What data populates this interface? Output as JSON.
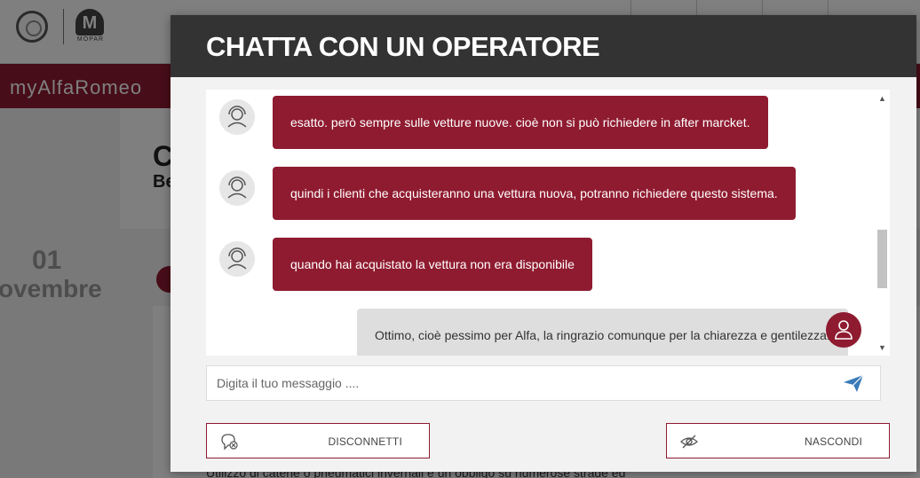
{
  "background": {
    "brand_name": "myAlfaRomeo",
    "logo_secondary_text": "MOPAR",
    "logo_secondary_letter": "M",
    "title_initial": "C",
    "subtitle_initial": "Be",
    "date_day": "01",
    "date_month": "ovembre",
    "bottom_text": "Utilizzo di catene o pneumatici invernali è un obbligo su numerose strade ed"
  },
  "modal": {
    "title": "CHATTA CON UN OPERATORE"
  },
  "messages": [
    {
      "sender": "operator",
      "text": "esatto. però sempre sulle vetture nuove. cioè non si può richiedere in after marcket."
    },
    {
      "sender": "operator",
      "text": "quindi i clienti che acquisteranno una vettura nuova, potranno richiedere questo sistema."
    },
    {
      "sender": "operator",
      "text": "quando hai acquistato la vettura non era disponibile"
    },
    {
      "sender": "user",
      "text": "Ottimo, cioè pessimo per Alfa, la ringrazio comunque per la chiarezza e gentilezza."
    }
  ],
  "input": {
    "placeholder": "Digita il tuo messaggio ....",
    "value": ""
  },
  "buttons": {
    "disconnect_label": "DISCONNETTI",
    "hide_label": "NASCONDI"
  },
  "icons": {
    "send": "send-icon",
    "disconnect": "chat-disconnect-icon",
    "hide": "eye-hidden-icon",
    "operator_avatar": "operator-headset-icon",
    "user_avatar": "user-icon"
  },
  "colors": {
    "brand": "#8f1b30",
    "header": "#333333",
    "operator_bubble": "#8f1b30",
    "user_bubble": "#dedede",
    "send_icon": "#3a7ab8"
  }
}
